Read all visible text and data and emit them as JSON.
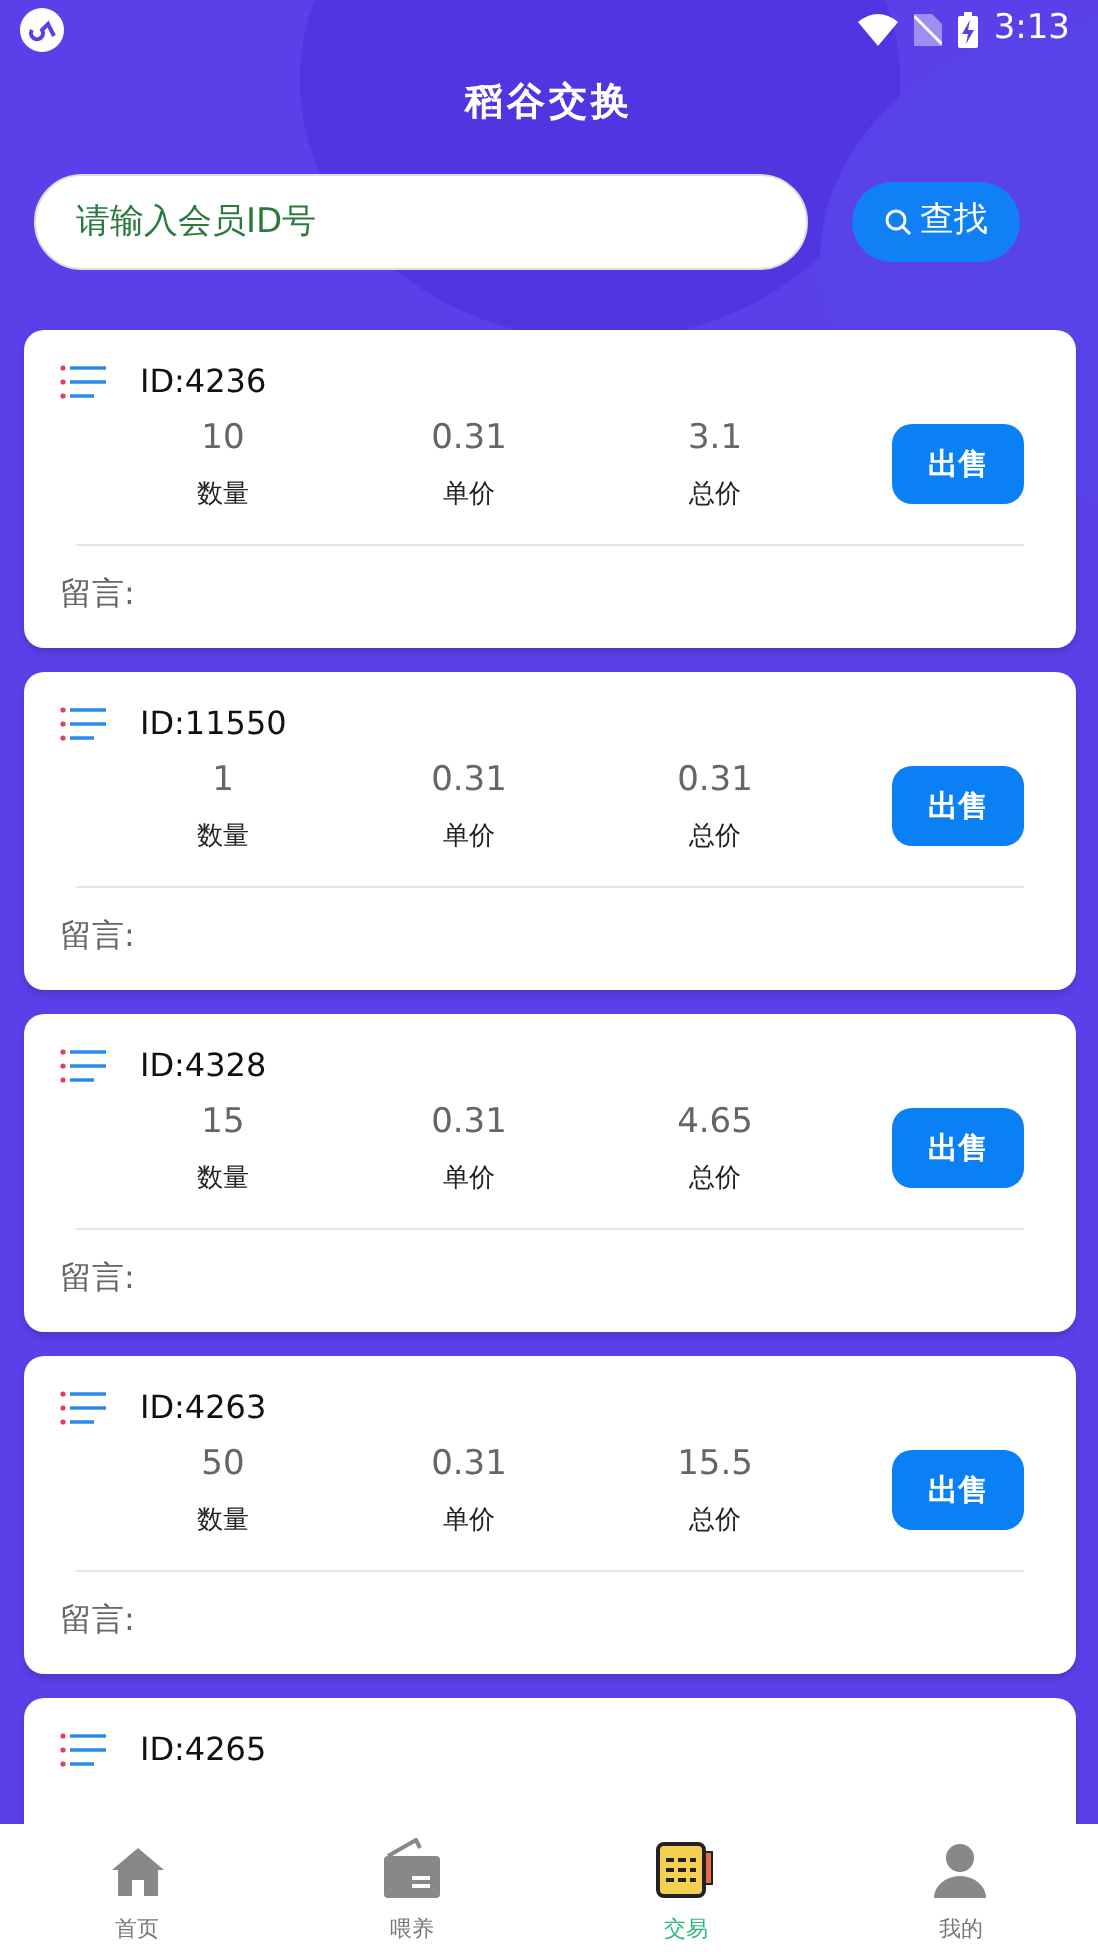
{
  "status_bar": {
    "time": "3:13"
  },
  "title": "稻谷交换",
  "search": {
    "placeholder": "请输入会员ID号",
    "button": "查找"
  },
  "orders": [
    {
      "id": "ID:4236",
      "quantity": "10",
      "quantity_label": "数量",
      "unit_price": "0.31",
      "unit_price_label": "单价",
      "total": "3.1",
      "total_label": "总价",
      "action": "出售",
      "message_label": "留言:"
    },
    {
      "id": "ID:11550",
      "quantity": "1",
      "quantity_label": "数量",
      "unit_price": "0.31",
      "unit_price_label": "单价",
      "total": "0.31",
      "total_label": "总价",
      "action": "出售",
      "message_label": "留言:"
    },
    {
      "id": "ID:4328",
      "quantity": "15",
      "quantity_label": "数量",
      "unit_price": "0.31",
      "unit_price_label": "单价",
      "total": "4.65",
      "total_label": "总价",
      "action": "出售",
      "message_label": "留言:"
    },
    {
      "id": "ID:4263",
      "quantity": "50",
      "quantity_label": "数量",
      "unit_price": "0.31",
      "unit_price_label": "单价",
      "total": "15.5",
      "total_label": "总价",
      "action": "出售",
      "message_label": "留言:"
    },
    {
      "id": "ID:4265"
    }
  ],
  "tabs": [
    {
      "label": "首页",
      "kind": "home",
      "selected": false
    },
    {
      "label": "喂养",
      "kind": "wallet",
      "selected": false
    },
    {
      "label": "交易",
      "kind": "notes",
      "selected": true
    },
    {
      "label": "我的",
      "kind": "person",
      "selected": false
    }
  ]
}
